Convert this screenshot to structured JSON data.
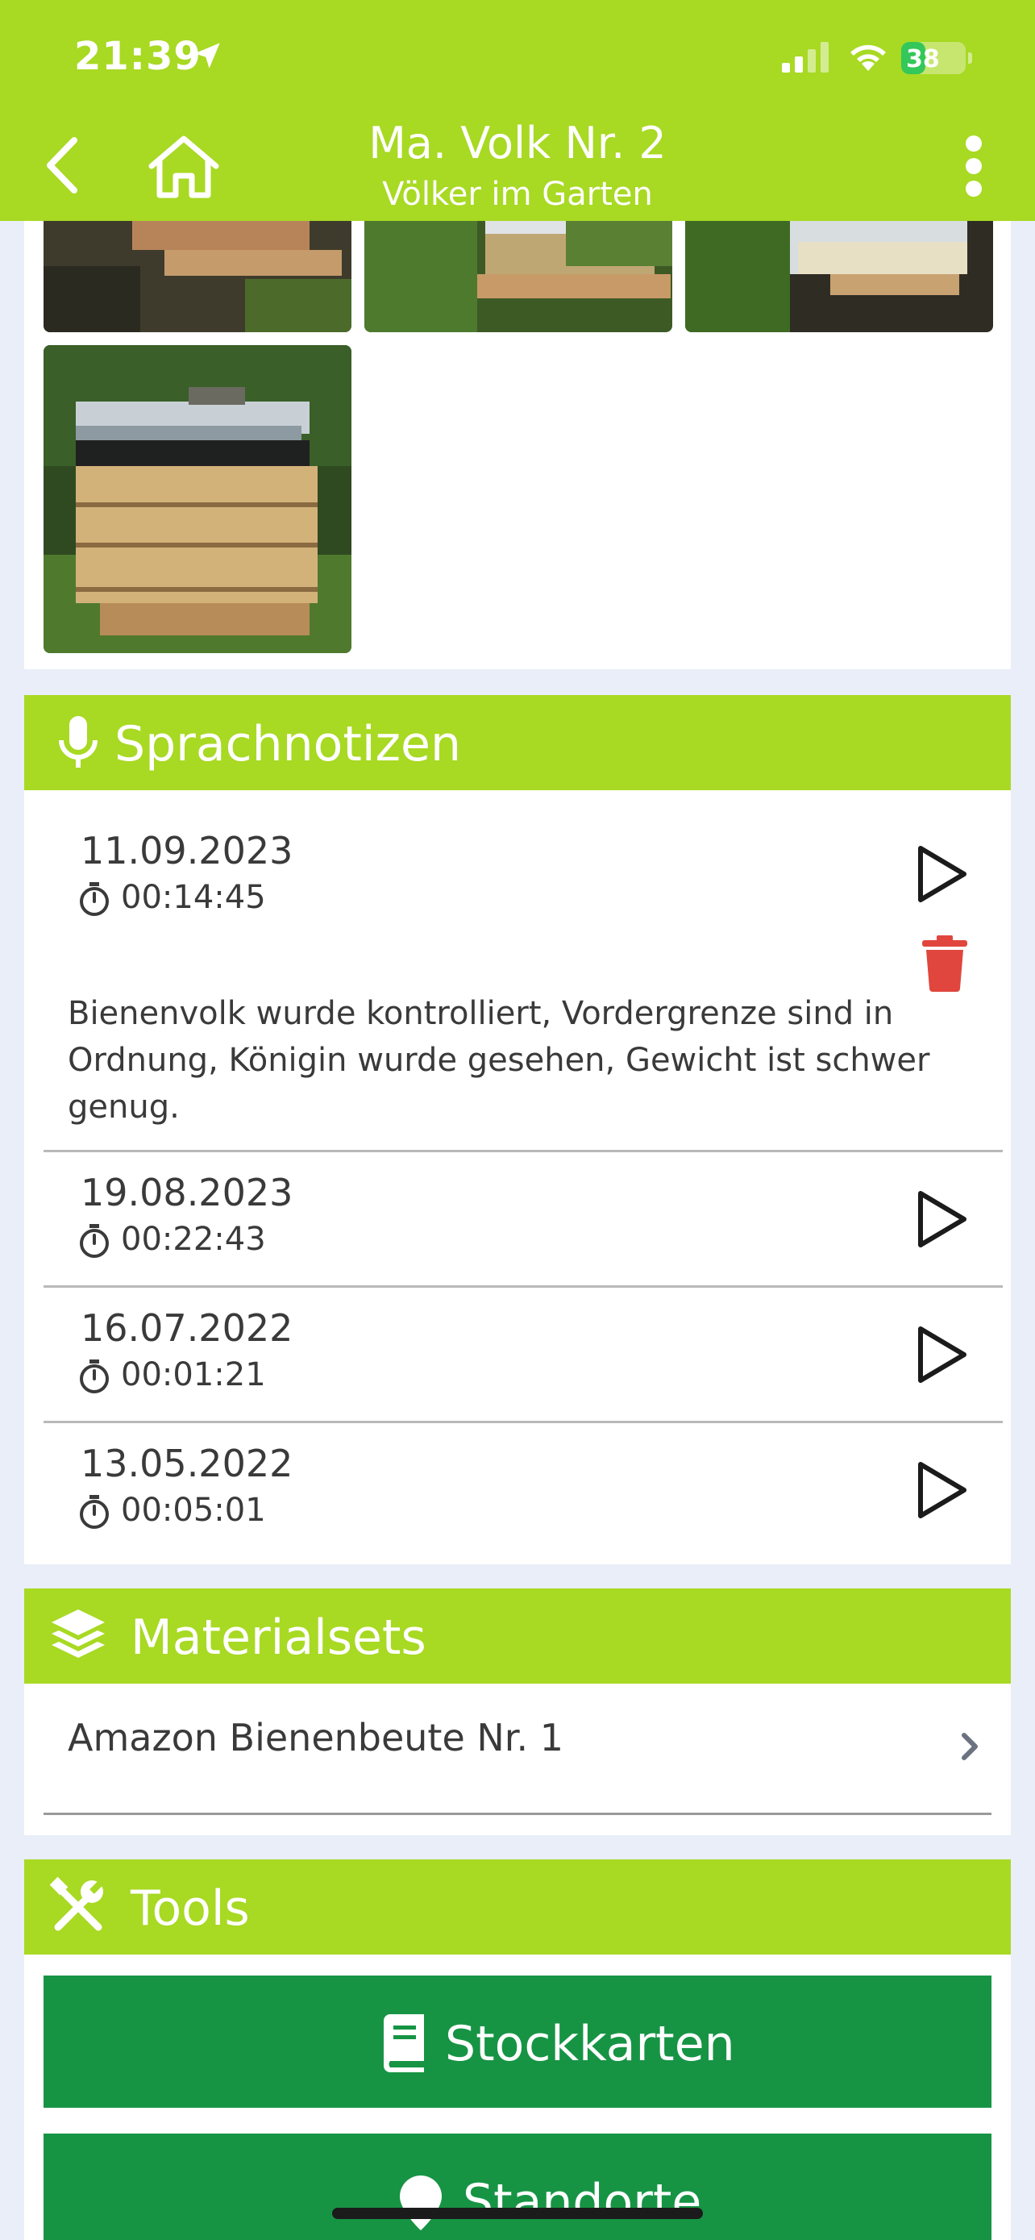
{
  "status_bar": {
    "time": "21:39",
    "battery": "38",
    "battery_level": 0.38
  },
  "nav": {
    "title": "Ma. Volk Nr. 2",
    "subtitle": "Völker im Garten"
  },
  "sections": {
    "voice_notes": "Sprachnotizen",
    "materials": "Materialsets",
    "tools": "Tools"
  },
  "voice_notes": [
    {
      "date": "11.09.2023",
      "duration": "00:14:45",
      "transcript": "Bienenvolk wurde kontrolliert, Vordergrenze sind in Ordnung, Königin wurde gesehen, Gewicht ist schwer genug."
    },
    {
      "date": "19.08.2023",
      "duration": "00:22:43"
    },
    {
      "date": "16.07.2022",
      "duration": "00:01:21"
    },
    {
      "date": "13.05.2022",
      "duration": "00:05:01"
    }
  ],
  "materials": [
    {
      "label": "Amazon Bienenbeute Nr. 1"
    }
  ],
  "tools": [
    {
      "label": "Stockkarten"
    },
    {
      "label": "Standorte"
    }
  ],
  "colors": {
    "header": "#a8d923",
    "button": "#169444",
    "danger": "#e0463d",
    "background": "#e9eef8"
  },
  "icons": [
    "location-arrow-icon",
    "signal-icon",
    "wifi-icon",
    "battery-icon",
    "back-icon",
    "home-icon",
    "more-icon",
    "microphone-icon",
    "timer-icon",
    "play-icon",
    "trash-icon",
    "layers-icon",
    "chevron-right-icon",
    "tools-icon",
    "book-icon",
    "map-pin-icon"
  ]
}
